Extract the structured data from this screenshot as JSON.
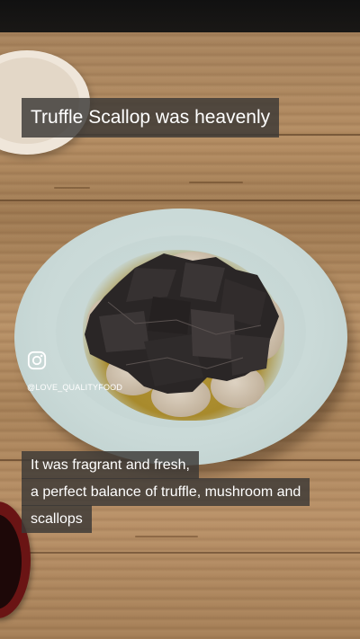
{
  "overlay": {
    "title": "Truffle Scallop was heavenly",
    "caption_lines": [
      "It was fragrant and fresh,",
      "a perfect balance of truffle, mushroom and",
      "scallops"
    ]
  },
  "watermark": {
    "icon": "instagram-icon",
    "handle": "@LOVE_QUALITYFOOD"
  },
  "colors": {
    "caption_background": "#3a3836",
    "caption_text": "#ffffff",
    "table_wood": "#a7835d",
    "plate": "#c9d9d7",
    "truffle": "#2b2727"
  }
}
